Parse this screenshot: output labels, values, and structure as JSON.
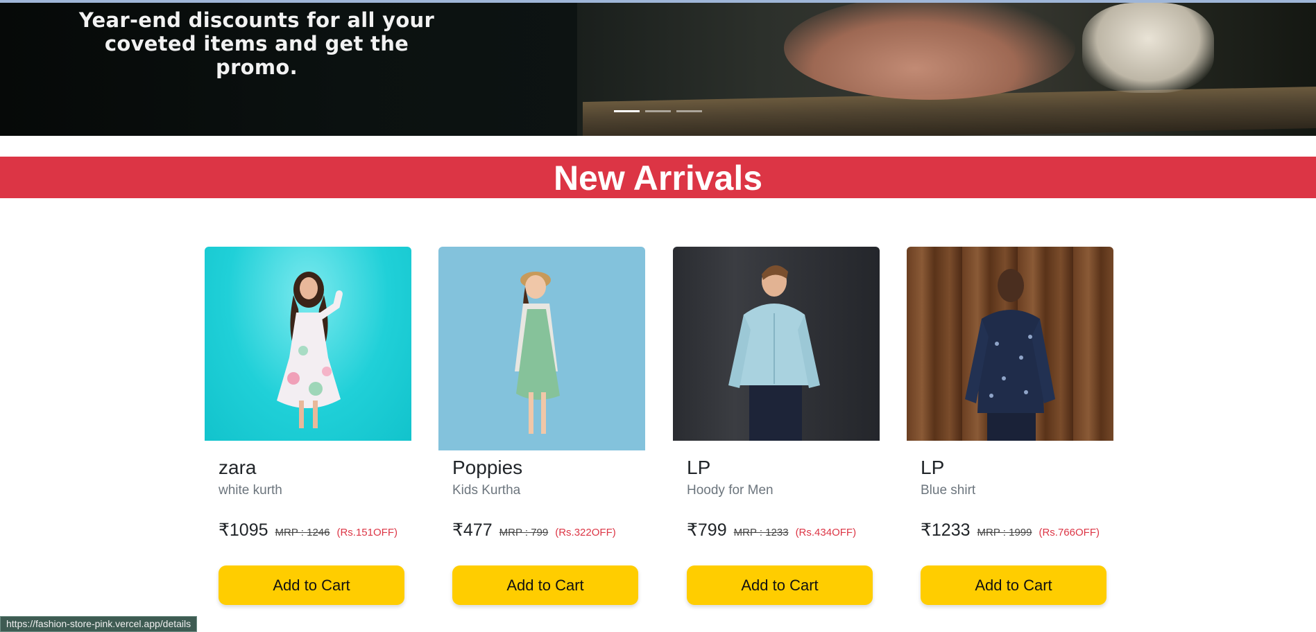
{
  "hero": {
    "caption": "Year-end discounts for all your coveted items and get the promo.",
    "indicators": 3,
    "active_indicator": 0
  },
  "section": {
    "title": "New Arrivals"
  },
  "products": [
    {
      "brand": "zara",
      "desc": "white kurth",
      "price": "₹1095",
      "mrp": "MRP : 1246",
      "off": "(Rs.151OFF)",
      "button": "Add to Cart"
    },
    {
      "brand": "Poppies",
      "desc": "Kids Kurtha",
      "price": "₹477",
      "mrp": "MRP : 799",
      "off": "(Rs.322OFF)",
      "button": "Add to Cart"
    },
    {
      "brand": "LP",
      "desc": "Hoody for Men",
      "price": "₹799",
      "mrp": "MRP : 1233",
      "off": "(Rs.434OFF)",
      "button": "Add to Cart"
    },
    {
      "brand": "LP",
      "desc": "Blue shirt",
      "price": "₹1233",
      "mrp": "MRP : 1999",
      "off": "(Rs.766OFF)",
      "button": "Add to Cart"
    }
  ],
  "status_bar": {
    "url": "https://fashion-store-pink.vercel.app/details"
  },
  "colors": {
    "banner": "#dc3545",
    "button": "#ffcd00",
    "off": "#dc3545"
  }
}
